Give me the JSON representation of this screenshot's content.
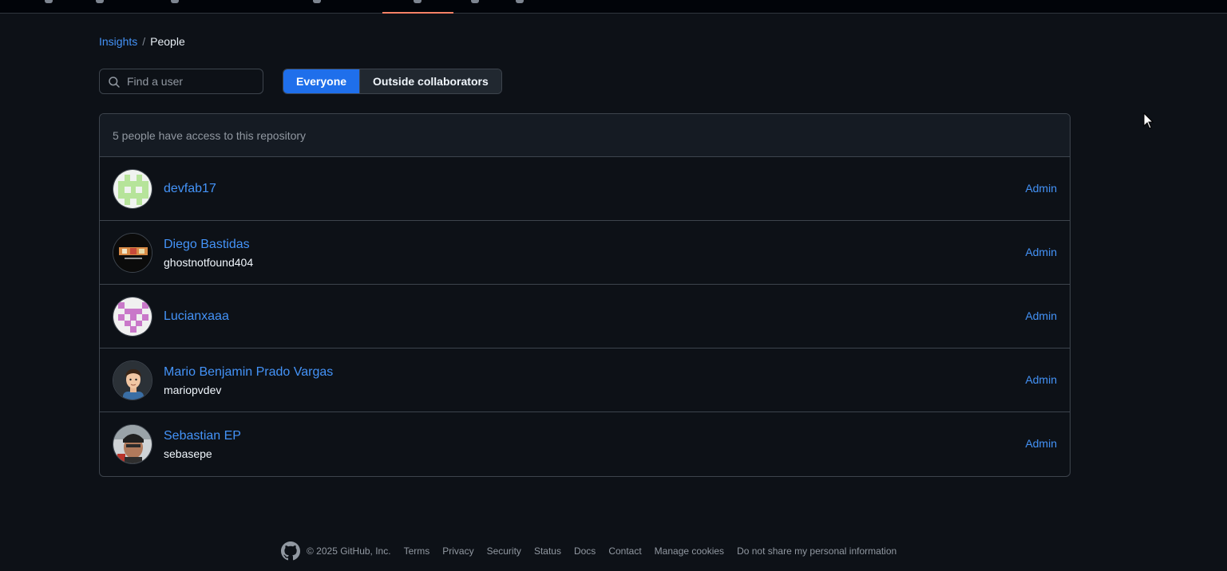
{
  "nav": {
    "active_tab_accent": "#f78166"
  },
  "breadcrumb": {
    "parent": "Insights",
    "separator": "/",
    "current": "People"
  },
  "search": {
    "placeholder": "Find a user",
    "value": "",
    "icon": "search-icon"
  },
  "filter": {
    "everyone": "Everyone",
    "outside": "Outside collaborators",
    "selected": "Everyone"
  },
  "panel": {
    "summary": "5 people have access to this repository"
  },
  "people": [
    {
      "display_name": "devfab17",
      "login": "",
      "role": "Admin",
      "avatar": "identicon-green"
    },
    {
      "display_name": "Diego Bastidas",
      "login": "ghostnotfound404",
      "role": "Admin",
      "avatar": "photo-dark"
    },
    {
      "display_name": "Lucianxaaa",
      "login": "",
      "role": "Admin",
      "avatar": "identicon-pink"
    },
    {
      "display_name": "Mario Benjamin Prado Vargas",
      "login": "mariopvdev",
      "role": "Admin",
      "avatar": "cartoon-person"
    },
    {
      "display_name": "Sebastian EP",
      "login": "sebasepe",
      "role": "Admin",
      "avatar": "photo-person"
    }
  ],
  "footer": {
    "copyright": "© 2025 GitHub, Inc.",
    "links": [
      "Terms",
      "Privacy",
      "Security",
      "Status",
      "Docs",
      "Contact",
      "Manage cookies",
      "Do not share my personal information"
    ]
  },
  "colors": {
    "background": "#0d1117",
    "link": "#4493f8",
    "selected_segment": "#1f6feb",
    "border": "#3d444d"
  }
}
